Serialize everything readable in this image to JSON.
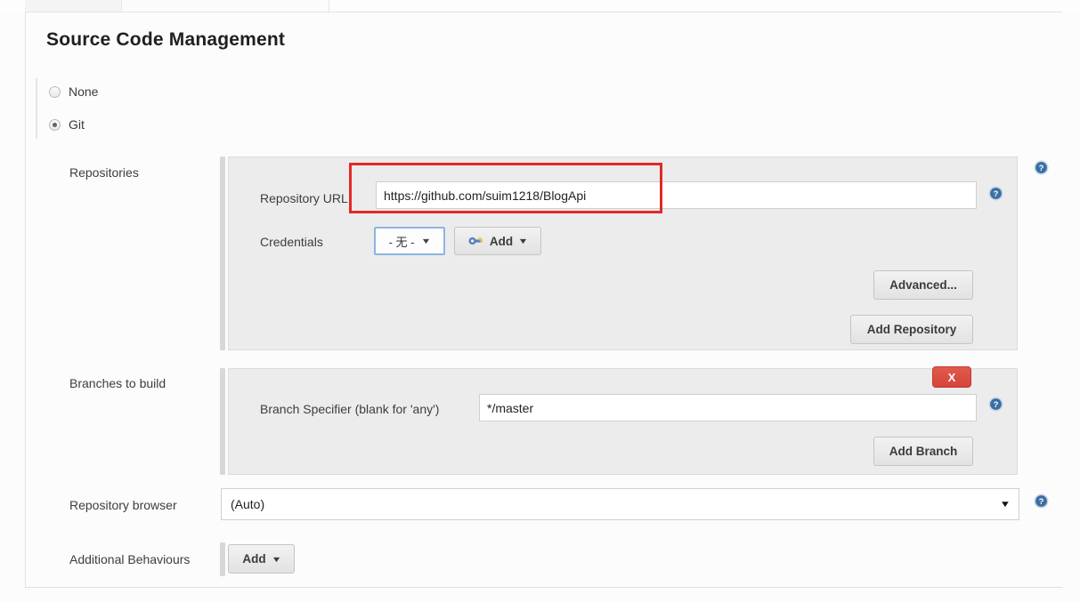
{
  "page": {
    "section_title": "Source Code Management"
  },
  "scm_type": {
    "options": [
      {
        "label": "None",
        "selected": false
      },
      {
        "label": "Git",
        "selected": true
      }
    ]
  },
  "rows": {
    "repositories_label": "Repositories",
    "branches_label": "Branches to build",
    "repository_browser_label": "Repository browser",
    "additional_behaviours_label": "Additional Behaviours"
  },
  "repository": {
    "url_label": "Repository URL",
    "url_value": "https://github.com/suim1218/BlogApi",
    "url_placeholder": "",
    "credentials_label": "Credentials",
    "credentials_value": "- 无 -",
    "credentials_add_label": "Add",
    "credentials_add_icon": "key-icon",
    "advanced_label": "Advanced...",
    "add_repository_label": "Add Repository"
  },
  "branches": {
    "specifier_label": "Branch Specifier (blank for 'any')",
    "specifier_value": "*/master",
    "specifier_placeholder": "",
    "add_branch_label": "Add Branch",
    "delete_label": "X"
  },
  "repository_browser": {
    "value": "(Auto)",
    "caret": "▼"
  },
  "additional_behaviours": {
    "add_label": "Add",
    "caret": "▼"
  },
  "icons": {
    "help": "?",
    "caret_down": "▼"
  },
  "colors": {
    "annotation_red": "#e02b26",
    "delete_red": "#d6453a",
    "help_blue": "#3a6ea5",
    "focus_blue": "#8cb4e2",
    "panel_grey": "#ececec",
    "page_bg": "#fcfcfc"
  }
}
